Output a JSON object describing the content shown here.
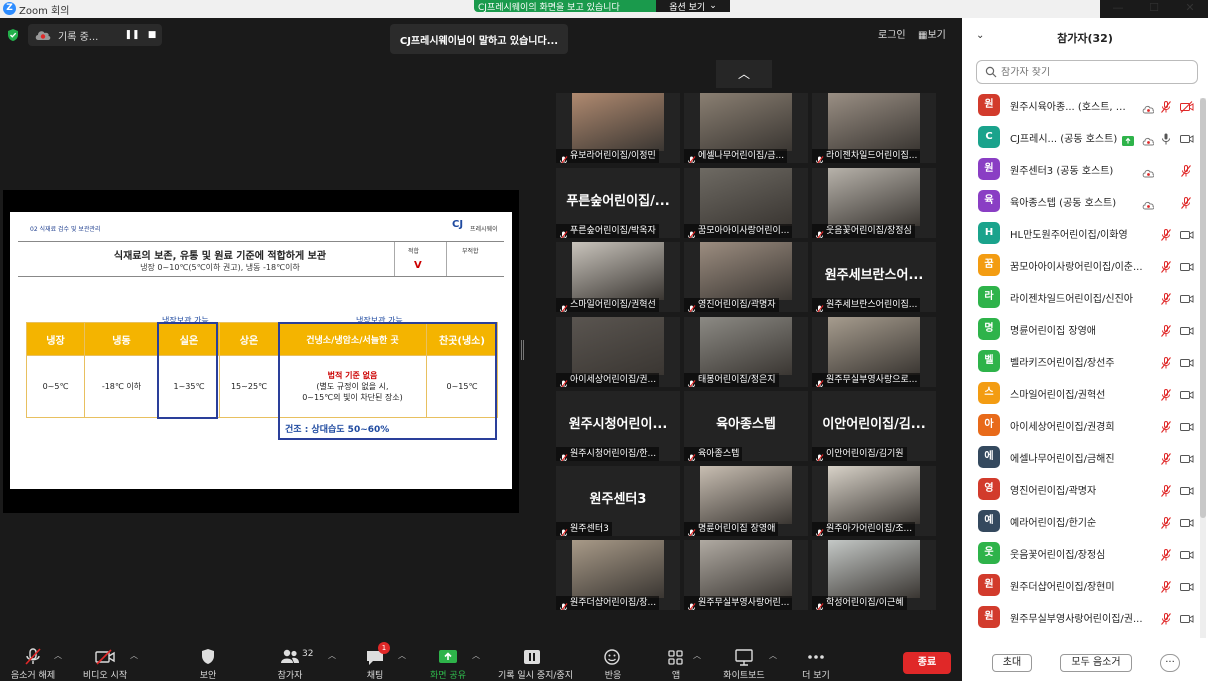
{
  "window": {
    "title": "Zoom 회의",
    "logo_letter": "Z",
    "share_banner": "CJ프레시웨이의 화면을 보고 있습니다",
    "share_options": "옵션 보기"
  },
  "meeting": {
    "recording_label": "기록 중...",
    "speaking_banner": "CJ프레시웨이님이 말하고 있습니다...",
    "login_label": "로그인",
    "view_label": "보기"
  },
  "slide": {
    "section_title": "02 식재료 검수 및 보관관리",
    "brand_mark": "CJ",
    "brand_name": "프레시웨이",
    "heading": "식재료의 보존, 유통 및 원료 기준에 적합하게 보관",
    "subheading": "냉장 0~10℃(5℃이하 권고), 냉동 -18℃이하",
    "col_fit": "적합",
    "col_unfit": "부적합",
    "check_mark": "V",
    "note_room": "냉장보관 가능",
    "note_cool": "냉장보관 가능",
    "headers": [
      "냉장",
      "냉동",
      "실온",
      "상온",
      "건냉소/냉암소/서늘한 곳",
      "찬곳(냉소)"
    ],
    "values": [
      "0~5℃",
      "-18℃ 이하",
      "1~35℃",
      "15~25℃",
      "",
      "0~15℃"
    ],
    "law_title": "법적 기준 없음",
    "law_line1": "(별도 규정이 없을 시,",
    "law_line2": "0~15℃의 빛이 차단된 장소)",
    "dry_note": "건조 : 상대습도 50~60%"
  },
  "grid": {
    "tiles": [
      {
        "name": "유보라어린이집/이정민",
        "big": "",
        "cam": "#b08a70"
      },
      {
        "name": "에셀나무어린이집/금...",
        "big": "",
        "cam": "#8a7f72"
      },
      {
        "name": "라이젠차일드어린이집...",
        "big": "",
        "cam": "#9a8f84"
      },
      {
        "name": "푸른숲어린이집/박옥자",
        "big": "푸른숲어린이집/...",
        "cam": ""
      },
      {
        "name": "꿈모아아이사랑어린이...",
        "big": "",
        "cam": "#6e6a63"
      },
      {
        "name": "웃음꽃어린이집/장정심",
        "big": "",
        "cam": "#b7b2aa"
      },
      {
        "name": "스마일어린이집/권혁선",
        "big": "",
        "cam": "#c9c4bc"
      },
      {
        "name": "영진어린이집/곽명자",
        "big": "",
        "cam": "#9c8d80"
      },
      {
        "name": "원주세브란스어린이집...",
        "big": "원주세브란스어...",
        "cam": ""
      },
      {
        "name": "아이세상어린이집/권...",
        "big": "",
        "cam": "#5a5550"
      },
      {
        "name": "태봉어린이집/정은지",
        "big": "",
        "cam": "#8c8a84"
      },
      {
        "name": "원주무실부영사랑으로...",
        "big": "",
        "cam": "#a69c8e"
      },
      {
        "name": "원주시청어린이집/한...",
        "big": "원주시청어린이...",
        "cam": ""
      },
      {
        "name": "육아종스텝",
        "big": "육아종스텝",
        "cam": ""
      },
      {
        "name": "이안어린이집/김기원",
        "big": "이안어린이집/김...",
        "cam": ""
      },
      {
        "name": "원주센터3",
        "big": "원주센터3",
        "cam": ""
      },
      {
        "name": "명륜어린이집 장영애",
        "big": "",
        "cam": "#c8beb2"
      },
      {
        "name": "원주아가어린이집/조...",
        "big": "",
        "cam": "#d8d2c8"
      },
      {
        "name": "원주더샵어린이집/장...",
        "big": "",
        "cam": "#a89a88"
      },
      {
        "name": "원주무실부영사랑어린...",
        "big": "",
        "cam": "#b0aaa2"
      },
      {
        "name": "학성어린이집/이근혜",
        "big": "",
        "cam": "#c4c8c6"
      }
    ]
  },
  "toolbar": {
    "mute": "음소거 해제",
    "video": "비디오 시작",
    "security": "보안",
    "participants": "참가자",
    "participants_count": "32",
    "chat": "채팅",
    "chat_badge": "1",
    "share": "화면 공유",
    "pause_share": "기록 일시 중지/중지",
    "reactions": "반응",
    "apps": "앱",
    "whiteboard": "화이트보드",
    "more": "더 보기",
    "end": "종료"
  },
  "panel": {
    "title": "참가자(32)",
    "search_placeholder": "참가자 찾기",
    "participants": [
      {
        "initial": "원",
        "color": "#d23b2c",
        "name": "원주시육아종... (호스트, 나)"
      },
      {
        "initial": "C",
        "color": "#1aa38c",
        "name": "CJ프레시... (공동 호스트)"
      },
      {
        "initial": "원",
        "color": "#8a3ec4",
        "name": "원주센터3 (공동 호스트)"
      },
      {
        "initial": "육",
        "color": "#8a3ec4",
        "name": "육아종스텝 (공동 호스트)"
      },
      {
        "initial": "H",
        "color": "#1aa38c",
        "name": "HL만도원주어린이집/이화영"
      },
      {
        "initial": "꿈",
        "color": "#f39c12",
        "name": "꿈모아아이사랑어린이집/이춘..."
      },
      {
        "initial": "라",
        "color": "#2eb34a",
        "name": "라이젠차일드어린이집/신진아"
      },
      {
        "initial": "명",
        "color": "#2eb34a",
        "name": "명륜어린이집 장영애"
      },
      {
        "initial": "벨",
        "color": "#2eb34a",
        "name": "벨라키즈어린이집/장선주"
      },
      {
        "initial": "스",
        "color": "#f39c12",
        "name": "스마일어린이집/권혁선"
      },
      {
        "initial": "아",
        "color": "#e86a1a",
        "name": "아이세상어린이집/권경희"
      },
      {
        "initial": "에",
        "color": "#34495e",
        "name": "에셀나무어린이집/금해진"
      },
      {
        "initial": "영",
        "color": "#d23b2c",
        "name": "영진어린이집/곽명자"
      },
      {
        "initial": "예",
        "color": "#34495e",
        "name": "예라어린이집/한기순"
      },
      {
        "initial": "웃",
        "color": "#2eb34a",
        "name": "웃음꽃어린이집/장정심"
      },
      {
        "initial": "원",
        "color": "#d23b2c",
        "name": "원주더샵어린이집/장현미"
      },
      {
        "initial": "원",
        "color": "#d23b2c",
        "name": "원주무실부영사랑어린이집/권..."
      }
    ],
    "invite": "초대",
    "mute_all": "모두 음소거",
    "more": "···"
  }
}
